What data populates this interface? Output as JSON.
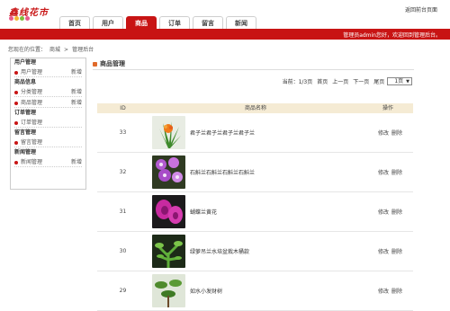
{
  "header": {
    "logo_text": "鑫线花市",
    "back_link": "返回前台页面"
  },
  "nav": {
    "tabs": [
      {
        "label": "首页",
        "active": false
      },
      {
        "label": "用户",
        "active": false
      },
      {
        "label": "商品",
        "active": true
      },
      {
        "label": "订单",
        "active": false
      },
      {
        "label": "留言",
        "active": false
      },
      {
        "label": "新闻",
        "active": false
      }
    ]
  },
  "welcome": "管理员admin您好，欢迎回到管理后台。",
  "breadcrumb": {
    "prefix": "您现在的位置：",
    "items": [
      "商城",
      ">",
      "管理后台"
    ]
  },
  "sidebar": {
    "groups": [
      {
        "title": "用户管理",
        "items": [
          {
            "label": "用户管理",
            "action": "新增"
          }
        ]
      },
      {
        "title": "商品信息",
        "items": [
          {
            "label": "分类管理",
            "action": "新增"
          },
          {
            "label": "商品管理",
            "action": "新增"
          }
        ]
      },
      {
        "title": "订单管理",
        "items": [
          {
            "label": "订单管理",
            "action": ""
          }
        ]
      },
      {
        "title": "留言管理",
        "items": [
          {
            "label": "留言管理",
            "action": ""
          }
        ]
      },
      {
        "title": "新闻管理",
        "items": [
          {
            "label": "新闻管理",
            "action": "新增"
          }
        ]
      }
    ]
  },
  "main": {
    "title": "商品管理",
    "pager": {
      "current": "当前：1/3页",
      "first": "首页",
      "prev": "上一页",
      "next": "下一页",
      "last": "尾页",
      "select_value": "1页"
    },
    "table": {
      "headers": {
        "id": "ID",
        "name": "商品名称",
        "ops": "操作"
      },
      "rows": [
        {
          "id": "33",
          "name": "君子兰君子兰君子兰君子兰",
          "edit": "修改",
          "del": "删除",
          "thumb": "clivia"
        },
        {
          "id": "32",
          "name": "石斛兰石斛兰石斛兰石斛兰",
          "edit": "修改",
          "del": "删除",
          "thumb": "dendrobium"
        },
        {
          "id": "31",
          "name": "蝴蝶兰黄花",
          "edit": "修改",
          "del": "删除",
          "thumb": "phalaenopsis"
        },
        {
          "id": "30",
          "name": "绿萝吊兰水培盆栽木桶款",
          "edit": "修改",
          "del": "删除",
          "thumb": "pothos"
        },
        {
          "id": "29",
          "name": "如水小发财树",
          "edit": "修改",
          "del": "删除",
          "thumb": "money-tree"
        }
      ]
    }
  },
  "colors": {
    "brand_red": "#c81414",
    "table_header": "#f5ebd4",
    "section_icon": "#e06a2a"
  }
}
